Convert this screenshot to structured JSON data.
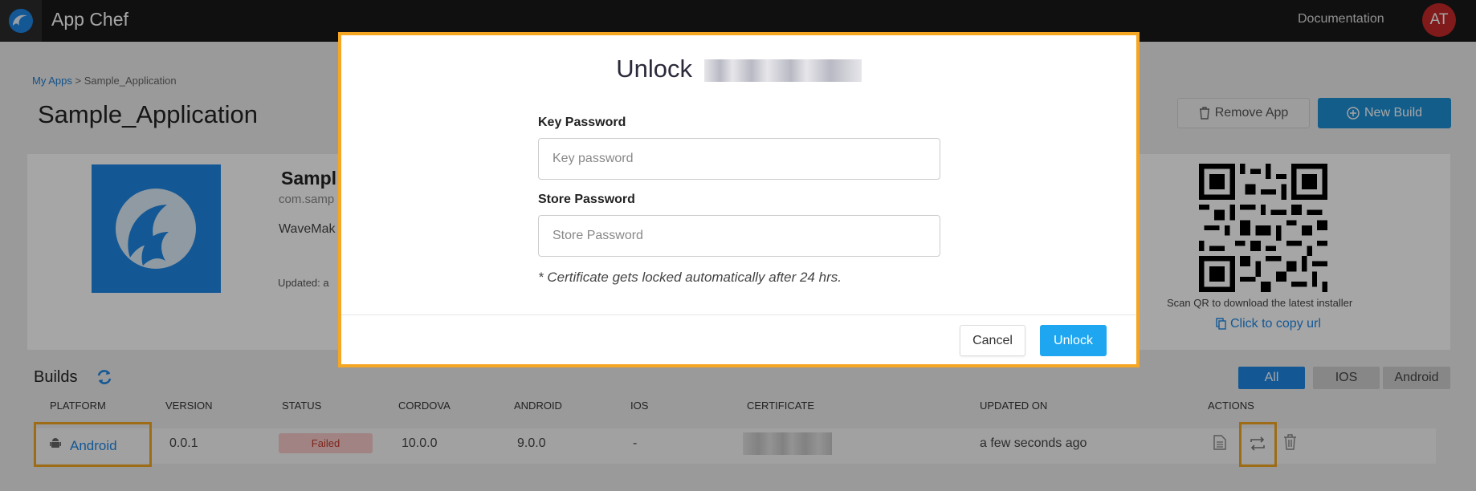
{
  "header": {
    "app_title": "App Chef",
    "documentation": "Documentation",
    "avatar_initials": "AT"
  },
  "breadcrumb": {
    "root": "My Apps",
    "separator": ">",
    "current": "Sample_Application"
  },
  "page": {
    "title": "Sample_Application",
    "remove_label": "Remove App",
    "new_build_label": "New Build"
  },
  "app_card": {
    "name": "Sampl",
    "package": "com.samp",
    "maker": "WaveMak",
    "updated": "Updated:    a",
    "qr_caption": "Scan QR to download the latest installer",
    "copy_url": "Click to copy url"
  },
  "builds": {
    "title": "Builds",
    "filters": [
      "All",
      "IOS",
      "Android"
    ],
    "active_filter": "All",
    "columns": [
      "PLATFORM",
      "VERSION",
      "STATUS",
      "CORDOVA",
      "ANDROID",
      "IOS",
      "CERTIFICATE",
      "UPDATED ON",
      "ACTIONS"
    ],
    "rows": [
      {
        "platform": "Android",
        "version": "0.0.1",
        "status": "Failed",
        "cordova": "10.0.0",
        "android": "9.0.0",
        "ios": "-",
        "updated_on": "a few seconds ago"
      }
    ]
  },
  "modal": {
    "title": "Unlock",
    "key_label": "Key Password",
    "key_placeholder": "Key password",
    "store_label": "Store Password",
    "store_placeholder": "Store Password",
    "note": "* Certificate gets locked automatically after 24 hrs.",
    "cancel": "Cancel",
    "unlock": "Unlock"
  },
  "colors": {
    "accent": "#1e87e5",
    "unlock_button": "#1ea7f0",
    "highlight": "#f5a623",
    "failed": "#c0392b"
  }
}
